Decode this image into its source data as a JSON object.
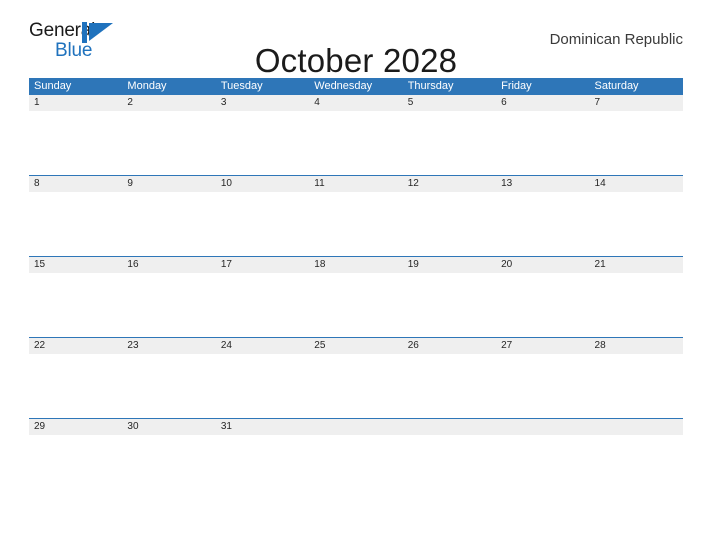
{
  "brand": {
    "name_part1": "General",
    "name_part2": "Blue",
    "flag_icon": "flag-triangle-icon",
    "accent_color": "#1f72bd"
  },
  "header": {
    "title": "October 2028",
    "country": "Dominican Republic"
  },
  "theme": {
    "header_blue": "#2e76b8",
    "date_band_gray": "#efefef",
    "text_dark": "#262626",
    "page_background": "#ffffff"
  },
  "calendar": {
    "month": "October",
    "year": "2028",
    "weekday_headers": [
      "Sunday",
      "Monday",
      "Tuesday",
      "Wednesday",
      "Thursday",
      "Friday",
      "Saturday"
    ],
    "weeks": [
      [
        "1",
        "2",
        "3",
        "4",
        "5",
        "6",
        "7"
      ],
      [
        "8",
        "9",
        "10",
        "11",
        "12",
        "13",
        "14"
      ],
      [
        "15",
        "16",
        "17",
        "18",
        "19",
        "20",
        "21"
      ],
      [
        "22",
        "23",
        "24",
        "25",
        "26",
        "27",
        "28"
      ],
      [
        "29",
        "30",
        "31",
        "",
        "",
        "",
        ""
      ]
    ]
  }
}
